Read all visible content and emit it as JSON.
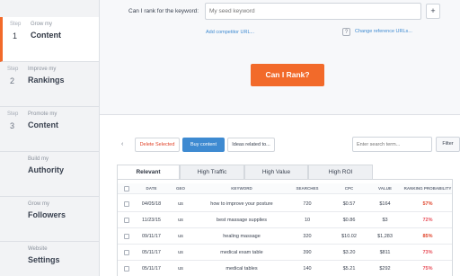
{
  "sidebar": {
    "items": [
      {
        "step_label": "Step",
        "num": "1",
        "small": "Grow my",
        "big": "Content",
        "active": true
      },
      {
        "step_label": "Step",
        "num": "2",
        "small": "Improve my",
        "big": "Rankings",
        "active": false
      },
      {
        "step_label": "Step",
        "num": "3",
        "small": "Promote my",
        "big": "Content",
        "active": false
      },
      {
        "step_label": "",
        "num": "",
        "small": "Build my",
        "big": "Authority",
        "active": false
      },
      {
        "step_label": "",
        "num": "",
        "small": "Grow my",
        "big": "Followers",
        "active": false
      },
      {
        "step_label": "",
        "num": "",
        "small": "Website",
        "big": "Settings",
        "active": false
      }
    ]
  },
  "top": {
    "keyword_label": "Can I rank for the keyword:",
    "keyword_placeholder": "My seed keyword",
    "plus_label": "+",
    "competitor_link": "Add competitor URL...",
    "help_icon": "?",
    "reference_link": "Change reference URLs...",
    "rank_button": "Can I Rank?"
  },
  "toolbar": {
    "chevron": "‹",
    "delete_label": "Delete Selected",
    "buy_label": "Buy content",
    "related_label": "Ideas related to...",
    "search_placeholder": "Enter search term...",
    "filter_label": "Filter"
  },
  "tabs": [
    "Relevant",
    "High Traffic",
    "High Value",
    "High ROI"
  ],
  "table": {
    "headers": [
      "DATE",
      "GEO",
      "KEYWORD",
      "SEARCHES",
      "CPC",
      "VALUE",
      "RANKING PROBABILITY"
    ],
    "rows": [
      {
        "date": "04/05/18",
        "geo": "us",
        "keyword": "how to improve your posture",
        "searches": "720",
        "cpc": "$0.57",
        "value": "$164",
        "prob": "57%"
      },
      {
        "date": "11/23/15",
        "geo": "us",
        "keyword": "best massage supplies",
        "searches": "10",
        "cpc": "$0.86",
        "value": "$3",
        "prob": "72%"
      },
      {
        "date": "09/11/17",
        "geo": "us",
        "keyword": "healing massage",
        "searches": "320",
        "cpc": "$10.02",
        "value": "$1,283",
        "prob": "85%"
      },
      {
        "date": "05/11/17",
        "geo": "us",
        "keyword": "medical exam table",
        "searches": "390",
        "cpc": "$3.20",
        "value": "$811",
        "prob": "73%"
      },
      {
        "date": "05/11/17",
        "geo": "us",
        "keyword": "medical tables",
        "searches": "140",
        "cpc": "$5.21",
        "value": "$292",
        "prob": "75%"
      }
    ]
  },
  "colors": {
    "accent": "#f26a2a",
    "link": "#3e8ad1",
    "danger": "#e0442a"
  }
}
